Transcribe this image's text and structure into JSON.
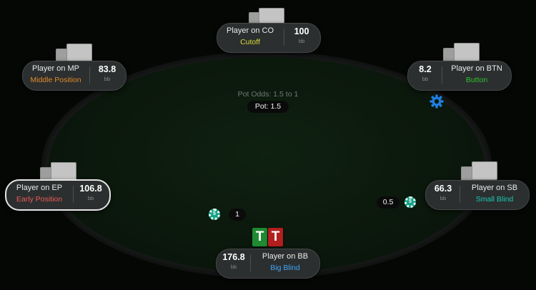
{
  "table": {
    "pot_odds": "Pot Odds: 1.5 to 1",
    "pot": "Pot: 1.5",
    "accent_felt": "#0b180c"
  },
  "seats": {
    "co": {
      "name": "Player on CO",
      "position": "Cutoff",
      "stack": "100",
      "unit": "bb",
      "color": "#d9d93a"
    },
    "mp": {
      "name": "Player on MP",
      "position": "Middle Position",
      "stack": "83.8",
      "unit": "bb",
      "color": "#e08a2a"
    },
    "btn": {
      "name": "Player on BTN",
      "position": "Button",
      "stack": "8.2",
      "unit": "bb",
      "color": "#2ec02e"
    },
    "ep": {
      "name": "Player on EP",
      "position": "Early Position",
      "stack": "106.8",
      "unit": "bb",
      "color": "#f05a5a"
    },
    "sb": {
      "name": "Player on SB",
      "position": "Small Blind",
      "stack": "66.3",
      "unit": "bb",
      "color": "#19c9b5"
    },
    "bb": {
      "name": "Player on BB",
      "position": "Big Blind",
      "stack": "176.8",
      "unit": "bb",
      "color": "#3fa7ff"
    }
  },
  "bets": {
    "bb_bet": "1",
    "sb_bet": "0.5"
  },
  "chips": {
    "bb_chip": "5",
    "sb_chip": "5"
  },
  "hero_cards": [
    {
      "rank": "T",
      "suit_color": "green"
    },
    {
      "rank": "T",
      "suit_color": "red"
    }
  ]
}
